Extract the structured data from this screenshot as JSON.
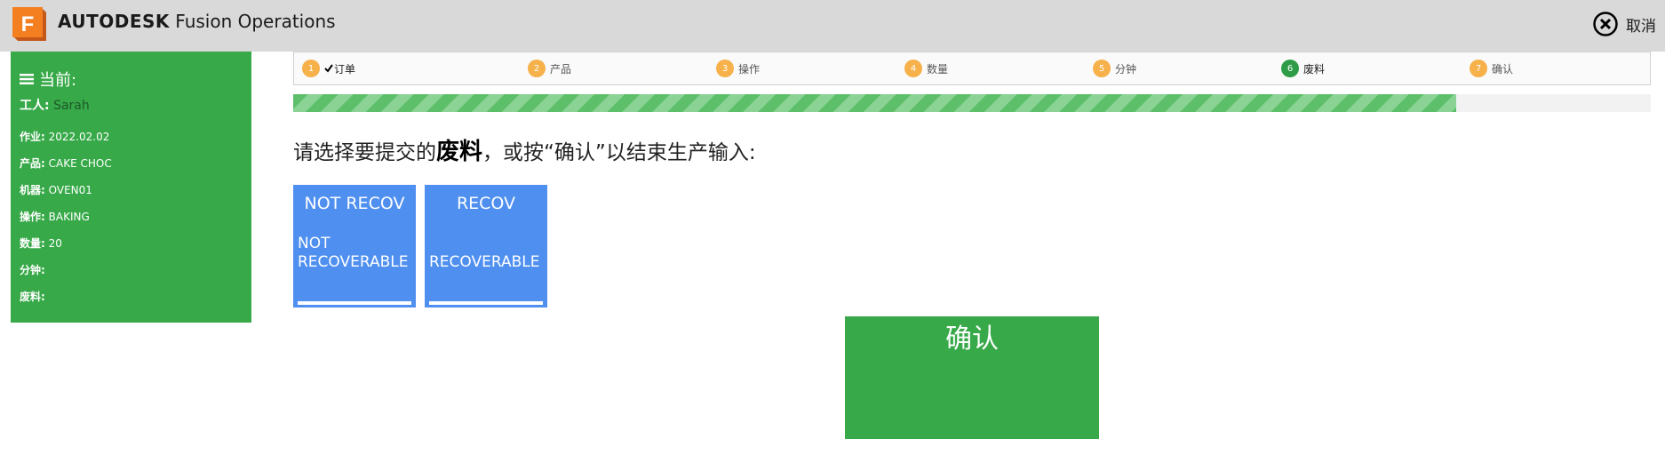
{
  "header": {
    "brand": "AUTODESK",
    "product": "Fusion Operations",
    "logo_letter": "F",
    "cancel_label": "取消"
  },
  "sidebar": {
    "title": "当前:",
    "worker_label": "工人:",
    "worker_value": "Sarah",
    "rows": [
      {
        "label": "作业:",
        "value": "2022.02.02"
      },
      {
        "label": "产品:",
        "value": "CAKE CHOC"
      },
      {
        "label": "机器:",
        "value": "OVEN01"
      },
      {
        "label": "操作:",
        "value": "BAKING"
      },
      {
        "label": "数量:",
        "value": "20"
      },
      {
        "label": "分钟:",
        "value": ""
      },
      {
        "label": "废料:",
        "value": ""
      }
    ]
  },
  "steps": [
    {
      "num": "1",
      "label": "订单",
      "state": "done"
    },
    {
      "num": "2",
      "label": "产品",
      "state": "pending"
    },
    {
      "num": "3",
      "label": "操作",
      "state": "pending"
    },
    {
      "num": "4",
      "label": "数量",
      "state": "pending"
    },
    {
      "num": "5",
      "label": "分钟",
      "state": "pending"
    },
    {
      "num": "6",
      "label": "废料",
      "state": "active"
    },
    {
      "num": "7",
      "label": "确认",
      "state": "pending"
    }
  ],
  "progress": {
    "fraction": 0.857
  },
  "prompt": {
    "before": "请选择要提交的",
    "emphasis": "废料",
    "after": "，或按“确认”以结束生产输入:"
  },
  "scrap_options": [
    {
      "code": "NOT RECOV",
      "line1": "NOT",
      "line2": "RECOVERABLE"
    },
    {
      "code": "RECOV",
      "line1": "",
      "line2": "RECOVERABLE"
    }
  ],
  "confirm_label": "确认",
  "colors": {
    "green": "#37a948",
    "blue": "#4e8ff0",
    "orange": "#f6b14a",
    "header_gray": "#d9d9d9"
  }
}
